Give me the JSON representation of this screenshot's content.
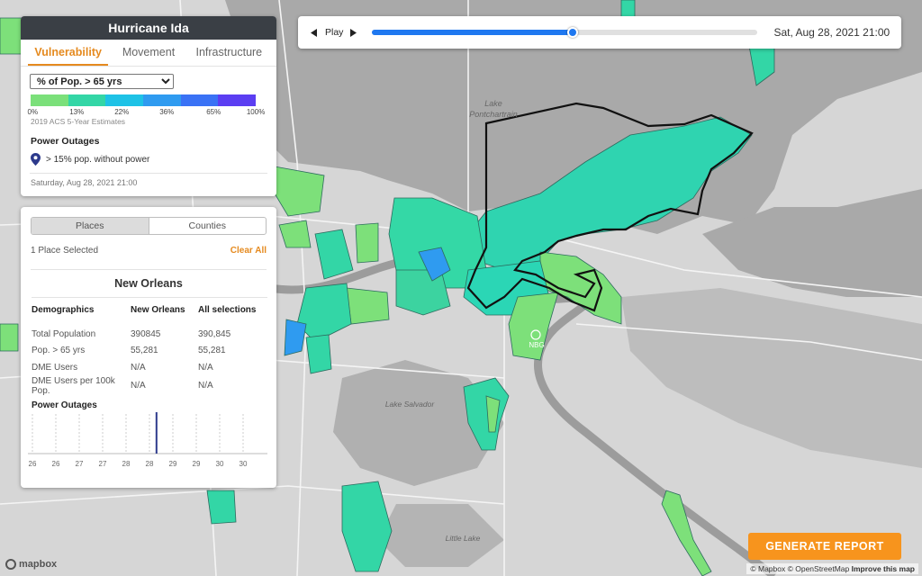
{
  "info": {
    "title": "Hurricane Ida",
    "tabs": [
      "Vulnerability",
      "Movement",
      "Infrastructure"
    ],
    "metric_selected": "% of Pop. > 65 yrs",
    "legend_colors": [
      "#7be07a",
      "#33d6a6",
      "#1ec2e6",
      "#2f9bf0",
      "#3a72f5",
      "#5b3ef2"
    ],
    "legend_ticks": [
      "0%",
      "13%",
      "22%",
      "36%",
      "65%",
      "100%"
    ],
    "source": "2019 ACS 5-Year Estimates",
    "outages_title": "Power Outages",
    "outage_legend": "> 15% pop. without power",
    "timestamp": "Saturday, Aug 28, 2021 21:00"
  },
  "selection": {
    "seg_places": "Places",
    "seg_counties": "Counties",
    "count_text": "1 Place Selected",
    "clear_all": "Clear All",
    "place_name": "New Orleans",
    "headers": [
      "Demographics",
      "New Orleans",
      "All selections"
    ],
    "rows": [
      [
        "Total Population",
        "390845",
        "390,845"
      ],
      [
        "Pop. > 65 yrs",
        "55,281",
        "55,281"
      ],
      [
        "DME Users",
        "N/A",
        "N/A"
      ],
      [
        "DME Users per 100k Pop.",
        "N/A",
        "N/A"
      ]
    ],
    "power_outages_title": "Power Outages",
    "outage_axis": [
      "26",
      "26",
      "27",
      "28",
      "28",
      "28",
      "29",
      "29",
      "30",
      "30"
    ],
    "outage_axis_labels": [
      "26",
      "26",
      "27",
      "27",
      "28",
      "28",
      "29",
      "29",
      "30",
      "30"
    ],
    "outage_marker_index": 5.3
  },
  "timeline": {
    "play_label": "Play",
    "progress": 0.52,
    "date": "Sat, Aug 28, 2021 21:00"
  },
  "map": {
    "water_labels": [
      "Lake\nPontchartrain",
      "Lake Salvador",
      "Little Lake"
    ],
    "airport_label": "NBG"
  },
  "generate_button": "GENERATE REPORT",
  "logo_text": "mapbox",
  "attribution": {
    "text": "© Mapbox © OpenStreetMap",
    "improve": "Improve this map"
  }
}
